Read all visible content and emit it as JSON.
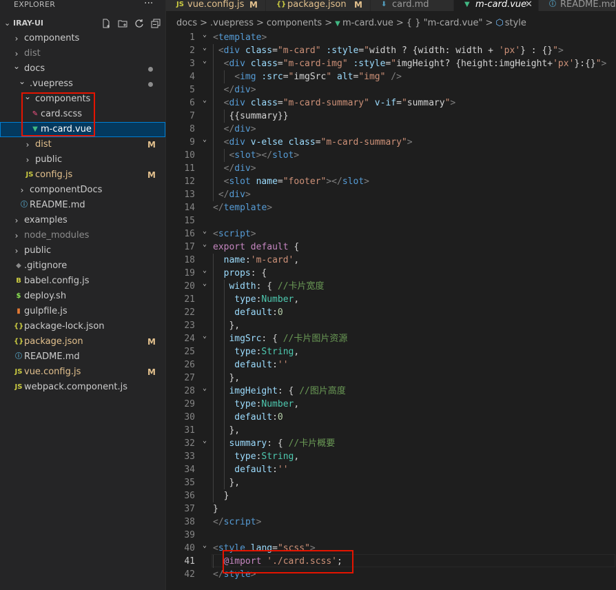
{
  "sidebar": {
    "title": "EXPLORER",
    "more": "···",
    "project": "IRAY-UI",
    "items": [
      {
        "label": "components",
        "kind": "folder",
        "open": false,
        "depth": 0,
        "color": "#cccccc"
      },
      {
        "label": "dist",
        "kind": "folder",
        "open": false,
        "depth": 0,
        "color": "#8c8c8c"
      },
      {
        "label": "docs",
        "kind": "folder",
        "open": true,
        "depth": 0,
        "color": "#cccccc",
        "dot": true
      },
      {
        "label": ".vuepress",
        "kind": "folder",
        "open": true,
        "depth": 1,
        "color": "#cccccc",
        "dot": true
      },
      {
        "label": "components",
        "kind": "folder",
        "open": true,
        "depth": 2,
        "color": "#cccccc"
      },
      {
        "label": "card.scss",
        "kind": "scss",
        "depth": 3,
        "color": "#cccccc"
      },
      {
        "label": "m-card.vue",
        "kind": "vue",
        "depth": 3,
        "color": "#ffffff",
        "selected": true
      },
      {
        "label": "dist",
        "kind": "folder",
        "open": false,
        "depth": 2,
        "color": "#e2c08d",
        "badge": "M"
      },
      {
        "label": "public",
        "kind": "folder",
        "open": false,
        "depth": 2,
        "color": "#cccccc"
      },
      {
        "label": "config.js",
        "kind": "js",
        "depth": 2,
        "color": "#e2c08d",
        "badge": "M"
      },
      {
        "label": "componentDocs",
        "kind": "folder",
        "open": false,
        "depth": 1,
        "color": "#cccccc"
      },
      {
        "label": "README.md",
        "kind": "info",
        "depth": 1,
        "color": "#cccccc"
      },
      {
        "label": "examples",
        "kind": "folder",
        "open": false,
        "depth": 0,
        "color": "#cccccc"
      },
      {
        "label": "node_modules",
        "kind": "folder",
        "open": false,
        "depth": 0,
        "color": "#8c8c8c"
      },
      {
        "label": "public",
        "kind": "folder",
        "open": false,
        "depth": 0,
        "color": "#cccccc"
      },
      {
        "label": ".gitignore",
        "kind": "git",
        "depth": 0,
        "color": "#cccccc"
      },
      {
        "label": "babel.config.js",
        "kind": "babel",
        "depth": 0,
        "color": "#cccccc"
      },
      {
        "label": "deploy.sh",
        "kind": "sh",
        "depth": 0,
        "color": "#cccccc"
      },
      {
        "label": "gulpfile.js",
        "kind": "gulp",
        "depth": 0,
        "color": "#cccccc"
      },
      {
        "label": "package-lock.json",
        "kind": "json",
        "depth": 0,
        "color": "#cccccc"
      },
      {
        "label": "package.json",
        "kind": "json",
        "depth": 0,
        "color": "#e2c08d",
        "badge": "M"
      },
      {
        "label": "README.md",
        "kind": "info",
        "depth": 0,
        "color": "#cccccc"
      },
      {
        "label": "vue.config.js",
        "kind": "js",
        "depth": 0,
        "color": "#e2c08d",
        "badge": "M"
      },
      {
        "label": "webpack.component.js",
        "kind": "webpack",
        "depth": 0,
        "color": "#cccccc"
      }
    ]
  },
  "tabs": [
    {
      "label": "vue.config.js",
      "kind": "js",
      "badge": "M",
      "color": "#e2c08d"
    },
    {
      "label": "package.json",
      "kind": "json",
      "badge": "M",
      "color": "#e2c08d"
    },
    {
      "label": "card.md",
      "kind": "md",
      "color": "#999999"
    },
    {
      "label": "m-card.vue",
      "kind": "vue",
      "active": true,
      "close": "✕",
      "color": "#ffffff"
    },
    {
      "label": "README.md",
      "kind": "info",
      "color": "#999999"
    }
  ],
  "breadcrumb": [
    "docs",
    ">",
    ".vuepress",
    ">",
    "components",
    ">",
    "m-card.vue",
    ">",
    "{ } \"m-card.vue\"",
    ">",
    "style"
  ],
  "editor": {
    "active_line": 41,
    "lines": [
      {
        "n": 1,
        "indent": 0,
        "fold": "v",
        "parts": [
          [
            "t",
            "<"
          ],
          [
            "tg",
            "template"
          ],
          [
            "t",
            ">"
          ]
        ]
      },
      {
        "n": 2,
        "indent": 1,
        "fold": "v",
        "parts": [
          [
            "t",
            "<"
          ],
          [
            "tg",
            "div"
          ],
          [
            "tx",
            " "
          ],
          [
            "at",
            "class"
          ],
          [
            "pu",
            "="
          ],
          [
            "st",
            "\"m-card\""
          ],
          [
            "tx",
            " "
          ],
          [
            "at",
            ":style"
          ],
          [
            "pu",
            "="
          ],
          [
            "st",
            "\""
          ],
          [
            "tx",
            "width ? {width: width + "
          ],
          [
            "st",
            "'px'"
          ],
          [
            "tx",
            "} : {}"
          ],
          [
            "st",
            "\""
          ],
          [
            "t",
            ">"
          ]
        ]
      },
      {
        "n": 3,
        "indent": 2,
        "fold": "v",
        "parts": [
          [
            "t",
            "<"
          ],
          [
            "tg",
            "div"
          ],
          [
            "tx",
            " "
          ],
          [
            "at",
            "class"
          ],
          [
            "pu",
            "="
          ],
          [
            "st",
            "\"m-card-img\""
          ],
          [
            "tx",
            " "
          ],
          [
            "at",
            ":style"
          ],
          [
            "pu",
            "="
          ],
          [
            "st",
            "\""
          ],
          [
            "tx",
            "imgHeight? {height:imgHeight+"
          ],
          [
            "st",
            "'px'"
          ],
          [
            "tx",
            "}:{}"
          ],
          [
            "st",
            "\""
          ],
          [
            "t",
            ">"
          ]
        ]
      },
      {
        "n": 4,
        "indent": 4,
        "fold": "",
        "parts": [
          [
            "t",
            "<"
          ],
          [
            "tg",
            "img"
          ],
          [
            "tx",
            " "
          ],
          [
            "at",
            ":src"
          ],
          [
            "pu",
            "="
          ],
          [
            "st",
            "\""
          ],
          [
            "tx",
            "imgSrc"
          ],
          [
            "st",
            "\""
          ],
          [
            "tx",
            " "
          ],
          [
            "at",
            "alt"
          ],
          [
            "pu",
            "="
          ],
          [
            "st",
            "\"img\""
          ],
          [
            "tx",
            " "
          ],
          [
            "t",
            "/>"
          ]
        ]
      },
      {
        "n": 5,
        "indent": 2,
        "fold": "",
        "parts": [
          [
            "t",
            "</"
          ],
          [
            "tg",
            "div"
          ],
          [
            "t",
            ">"
          ]
        ]
      },
      {
        "n": 6,
        "indent": 2,
        "fold": "v",
        "parts": [
          [
            "t",
            "<"
          ],
          [
            "tg",
            "div"
          ],
          [
            "tx",
            " "
          ],
          [
            "at",
            "class"
          ],
          [
            "pu",
            "="
          ],
          [
            "st",
            "\"m-card-summary\""
          ],
          [
            "tx",
            " "
          ],
          [
            "at",
            "v-if"
          ],
          [
            "pu",
            "="
          ],
          [
            "st",
            "\""
          ],
          [
            "tx",
            "summary"
          ],
          [
            "st",
            "\""
          ],
          [
            "t",
            ">"
          ]
        ]
      },
      {
        "n": 7,
        "indent": 3,
        "fold": "",
        "parts": [
          [
            "tx",
            "{{summary}}"
          ]
        ]
      },
      {
        "n": 8,
        "indent": 2,
        "fold": "",
        "parts": [
          [
            "t",
            "</"
          ],
          [
            "tg",
            "div"
          ],
          [
            "t",
            ">"
          ]
        ]
      },
      {
        "n": 9,
        "indent": 2,
        "fold": "v",
        "parts": [
          [
            "t",
            "<"
          ],
          [
            "tg",
            "div"
          ],
          [
            "tx",
            " "
          ],
          [
            "at",
            "v-else"
          ],
          [
            "tx",
            " "
          ],
          [
            "at",
            "class"
          ],
          [
            "pu",
            "="
          ],
          [
            "st",
            "\"m-card-summary\""
          ],
          [
            "t",
            ">"
          ]
        ]
      },
      {
        "n": 10,
        "indent": 3,
        "fold": "",
        "parts": [
          [
            "t",
            "<"
          ],
          [
            "tg",
            "slot"
          ],
          [
            "t",
            "></"
          ],
          [
            "tg",
            "slot"
          ],
          [
            "t",
            ">"
          ]
        ]
      },
      {
        "n": 11,
        "indent": 2,
        "fold": "",
        "parts": [
          [
            "t",
            "</"
          ],
          [
            "tg",
            "div"
          ],
          [
            "t",
            ">"
          ]
        ]
      },
      {
        "n": 12,
        "indent": 2,
        "fold": "",
        "parts": [
          [
            "t",
            "<"
          ],
          [
            "tg",
            "slot"
          ],
          [
            "tx",
            " "
          ],
          [
            "at",
            "name"
          ],
          [
            "pu",
            "="
          ],
          [
            "st",
            "\"footer\""
          ],
          [
            "t",
            "></"
          ],
          [
            "tg",
            "slot"
          ],
          [
            "t",
            ">"
          ]
        ]
      },
      {
        "n": 13,
        "indent": 1,
        "fold": "",
        "parts": [
          [
            "t",
            "</"
          ],
          [
            "tg",
            "div"
          ],
          [
            "t",
            ">"
          ]
        ]
      },
      {
        "n": 14,
        "indent": 0,
        "fold": "",
        "parts": [
          [
            "t",
            "</"
          ],
          [
            "tg",
            "template"
          ],
          [
            "t",
            ">"
          ]
        ]
      },
      {
        "n": 15,
        "indent": 0,
        "fold": "",
        "parts": []
      },
      {
        "n": 16,
        "indent": 0,
        "fold": "v",
        "parts": [
          [
            "t",
            "<"
          ],
          [
            "tg",
            "script"
          ],
          [
            "t",
            ">"
          ]
        ]
      },
      {
        "n": 17,
        "indent": 0,
        "fold": "v",
        "parts": [
          [
            "kw",
            "export"
          ],
          [
            "tx",
            " "
          ],
          [
            "kw",
            "default"
          ],
          [
            "tx",
            " {"
          ]
        ]
      },
      {
        "n": 18,
        "indent": 2,
        "fold": "",
        "parts": [
          [
            "at",
            "name"
          ],
          [
            "tx",
            ":"
          ],
          [
            "st",
            "'m-card'"
          ],
          [
            "tx",
            ","
          ]
        ]
      },
      {
        "n": 19,
        "indent": 2,
        "fold": "v",
        "parts": [
          [
            "at",
            "props"
          ],
          [
            "tx",
            ": {"
          ]
        ]
      },
      {
        "n": 20,
        "indent": 3,
        "fold": "v",
        "parts": [
          [
            "at",
            "width"
          ],
          [
            "tx",
            ": { "
          ],
          [
            "cm",
            "//卡片宽度"
          ]
        ]
      },
      {
        "n": 21,
        "indent": 4,
        "fold": "",
        "parts": [
          [
            "at",
            "type"
          ],
          [
            "tx",
            ":"
          ],
          [
            "ty",
            "Number"
          ],
          [
            "tx",
            ","
          ]
        ]
      },
      {
        "n": 22,
        "indent": 4,
        "fold": "",
        "parts": [
          [
            "at",
            "default"
          ],
          [
            "tx",
            ":"
          ],
          [
            "nu",
            "0"
          ]
        ]
      },
      {
        "n": 23,
        "indent": 3,
        "fold": "",
        "parts": [
          [
            "tx",
            "},"
          ]
        ]
      },
      {
        "n": 24,
        "indent": 3,
        "fold": "v",
        "parts": [
          [
            "at",
            "imgSrc"
          ],
          [
            "tx",
            ": { "
          ],
          [
            "cm",
            "//卡片图片资源"
          ]
        ]
      },
      {
        "n": 25,
        "indent": 4,
        "fold": "",
        "parts": [
          [
            "at",
            "type"
          ],
          [
            "tx",
            ":"
          ],
          [
            "ty",
            "String"
          ],
          [
            "tx",
            ","
          ]
        ]
      },
      {
        "n": 26,
        "indent": 4,
        "fold": "",
        "parts": [
          [
            "at",
            "default"
          ],
          [
            "tx",
            ":"
          ],
          [
            "st",
            "''"
          ]
        ]
      },
      {
        "n": 27,
        "indent": 3,
        "fold": "",
        "parts": [
          [
            "tx",
            "},"
          ]
        ]
      },
      {
        "n": 28,
        "indent": 3,
        "fold": "v",
        "parts": [
          [
            "at",
            "imgHeight"
          ],
          [
            "tx",
            ": { "
          ],
          [
            "cm",
            "//图片高度"
          ]
        ]
      },
      {
        "n": 29,
        "indent": 4,
        "fold": "",
        "parts": [
          [
            "at",
            "type"
          ],
          [
            "tx",
            ":"
          ],
          [
            "ty",
            "Number"
          ],
          [
            "tx",
            ","
          ]
        ]
      },
      {
        "n": 30,
        "indent": 4,
        "fold": "",
        "parts": [
          [
            "at",
            "default"
          ],
          [
            "tx",
            ":"
          ],
          [
            "nu",
            "0"
          ]
        ]
      },
      {
        "n": 31,
        "indent": 3,
        "fold": "",
        "parts": [
          [
            "tx",
            "},"
          ]
        ]
      },
      {
        "n": 32,
        "indent": 3,
        "fold": "v",
        "parts": [
          [
            "at",
            "summary"
          ],
          [
            "tx",
            ": { "
          ],
          [
            "cm",
            "//卡片概要"
          ]
        ]
      },
      {
        "n": 33,
        "indent": 4,
        "fold": "",
        "parts": [
          [
            "at",
            "type"
          ],
          [
            "tx",
            ":"
          ],
          [
            "ty",
            "String"
          ],
          [
            "tx",
            ","
          ]
        ]
      },
      {
        "n": 34,
        "indent": 4,
        "fold": "",
        "parts": [
          [
            "at",
            "default"
          ],
          [
            "tx",
            ":"
          ],
          [
            "st",
            "''"
          ]
        ]
      },
      {
        "n": 35,
        "indent": 3,
        "fold": "",
        "parts": [
          [
            "tx",
            "},"
          ]
        ]
      },
      {
        "n": 36,
        "indent": 2,
        "fold": "",
        "parts": [
          [
            "tx",
            "}"
          ]
        ]
      },
      {
        "n": 37,
        "indent": 0,
        "fold": "",
        "parts": [
          [
            "tx",
            "}"
          ]
        ]
      },
      {
        "n": 38,
        "indent": 0,
        "fold": "",
        "parts": [
          [
            "t",
            "</"
          ],
          [
            "tg",
            "script"
          ],
          [
            "t",
            ">"
          ]
        ]
      },
      {
        "n": 39,
        "indent": 0,
        "fold": "",
        "parts": []
      },
      {
        "n": 40,
        "indent": 0,
        "fold": "v",
        "parts": [
          [
            "t",
            "<"
          ],
          [
            "tg",
            "style"
          ],
          [
            "tx",
            " "
          ],
          [
            "at",
            "lang"
          ],
          [
            "pu",
            "="
          ],
          [
            "st",
            "\"scss\""
          ],
          [
            "t",
            ">"
          ]
        ]
      },
      {
        "n": 41,
        "indent": 2,
        "fold": "",
        "parts": [
          [
            "kw",
            "@import"
          ],
          [
            "tx",
            " "
          ],
          [
            "st",
            "'./card.scss'"
          ],
          [
            "tx",
            ";"
          ]
        ]
      },
      {
        "n": 42,
        "indent": 0,
        "fold": "",
        "parts": [
          [
            "t",
            "</"
          ],
          [
            "tg",
            "style"
          ],
          [
            "t",
            ">"
          ]
        ]
      }
    ]
  }
}
